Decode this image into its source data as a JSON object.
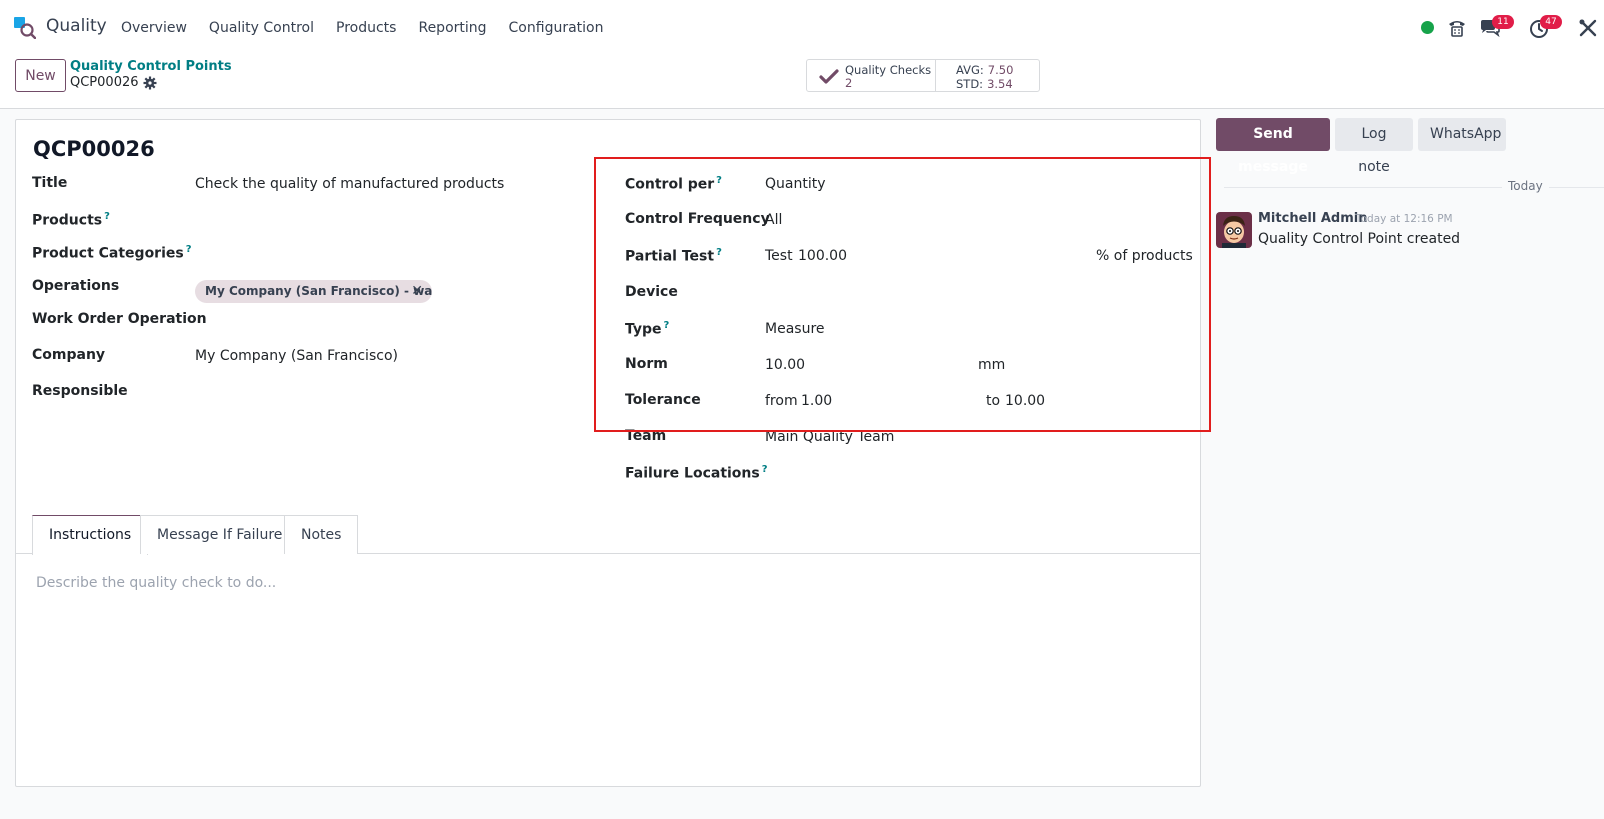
{
  "navbar": {
    "app_name": "Quality",
    "menu": [
      "Overview",
      "Quality Control",
      "Products",
      "Reporting",
      "Configuration"
    ],
    "messages_count": "11",
    "activities_count": "47"
  },
  "control_panel": {
    "new_label": "New",
    "breadcrumb_parent": "Quality Control Points",
    "breadcrumb_current": "QCP00026",
    "checks_label": "Quality Checks",
    "checks_count": "2",
    "avg_label": "AVG:",
    "avg_value": "7.50",
    "std_label": "STD:",
    "std_value": "3.54"
  },
  "form": {
    "record_name": "QCP00026",
    "left": {
      "title_label": "Title",
      "title_value": "Check the quality of manufactured products",
      "products_label": "Products",
      "product_categories_label": "Product Categories",
      "operations_label": "Operations",
      "operations_tag": "My Company (San Francisco) - war...",
      "work_order_label": "Work Order Operation",
      "company_label": "Company",
      "company_value": "My Company (San Francisco)",
      "responsible_label": "Responsible"
    },
    "right": {
      "control_per_label": "Control per",
      "control_per_value": "Quantity",
      "control_freq_label": "Control Frequency",
      "control_freq_value": "All",
      "partial_test_label": "Partial Test",
      "partial_test_prefix": "Test",
      "partial_test_value": "100.00",
      "partial_test_suffix": "% of products",
      "device_label": "Device",
      "type_label": "Type",
      "type_value": "Measure",
      "norm_label": "Norm",
      "norm_value": "10.00",
      "norm_unit": "mm",
      "tolerance_label": "Tolerance",
      "tolerance_from_prefix": "from",
      "tolerance_from": "1.00",
      "tolerance_to_prefix": "to",
      "tolerance_to": "10.00",
      "team_label": "Team",
      "team_value": "Main Quality Team",
      "failure_locations_label": "Failure Locations"
    },
    "tabs": [
      "Instructions",
      "Message If Failure",
      "Notes"
    ],
    "instructions_placeholder": "Describe the quality check to do..."
  },
  "chatter": {
    "send_message": "Send message",
    "log_note": "Log note",
    "whatsapp": "WhatsApp",
    "date_separator": "Today",
    "author": "Mitchell Admin",
    "time": "Today at 12:16 PM",
    "message": "Quality Control Point created"
  },
  "colors": {
    "brand": "#714b67",
    "link": "#017e84",
    "highlight_box": "#e11d1d",
    "badge": "#e11d48",
    "online": "#16a34a"
  }
}
